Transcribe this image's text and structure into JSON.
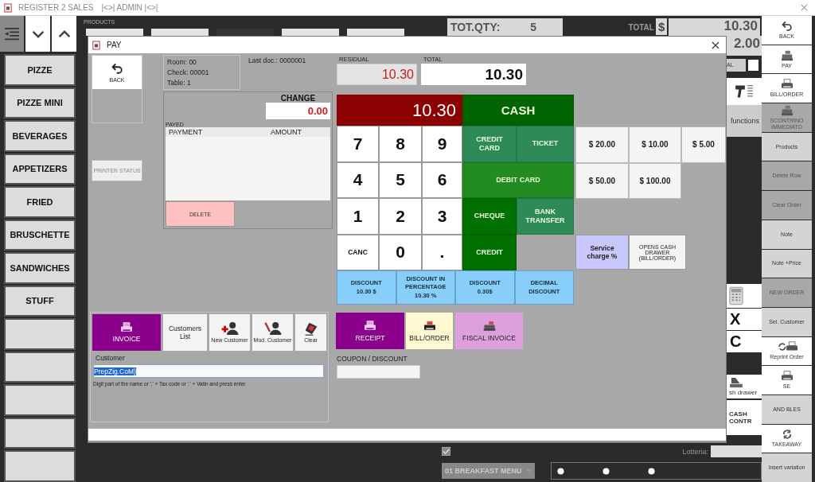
{
  "window": {
    "title": "REGISTER 2 SALES",
    "session": "|<>| ADMIN |<>|"
  },
  "categories": [
    {
      "label": "PIZZE"
    },
    {
      "label": "PIZZE MINI"
    },
    {
      "label": "BEVERAGES"
    },
    {
      "label": "APPETIZERS"
    },
    {
      "label": "FRIED"
    },
    {
      "label": "BRUSCHETTE"
    },
    {
      "label": "SANDWICHES"
    },
    {
      "label": "STUFF"
    }
  ],
  "products": {
    "title": "PRODUCTS"
  },
  "summary": {
    "qty_label": "TOT.QTY:",
    "qty": "5",
    "total_label": "TOTAL",
    "currency": "$",
    "total": "10.30",
    "subtotal": "2.00",
    "subtotal_label": "AL"
  },
  "side_panel": {
    "functions": "functions",
    "clear_x": "X",
    "clear_c": "C",
    "drawer": "sh drawer",
    "cash_control": "CASH CONTR"
  },
  "right_menu": [
    {
      "label": "BACK",
      "kind": "back",
      "disabled": false
    },
    {
      "label": "PAY",
      "kind": "register",
      "disabled": false
    },
    {
      "label": "BILL/ORDER",
      "kind": "printer",
      "disabled": false
    },
    {
      "label": "SCONTRINO IMMEDIATO",
      "kind": "register",
      "disabled": true
    },
    {
      "label": "Products",
      "kind": "plain",
      "disabled": false
    },
    {
      "label": "Delete Row",
      "kind": "plain",
      "disabled": true
    },
    {
      "label": "Clear Order",
      "kind": "plain",
      "disabled": true
    },
    {
      "label": "Note",
      "kind": "plain",
      "disabled": false
    },
    {
      "label": "Note +Price",
      "kind": "plain",
      "disabled": false
    },
    {
      "label": "NEW ORDER",
      "kind": "plain",
      "disabled": true
    },
    {
      "label": "Sel. Customer",
      "kind": "plain",
      "disabled": false
    },
    {
      "label": "Reprint Order",
      "kind": "reprint",
      "disabled": false
    },
    {
      "label": "SE",
      "kind": "printer",
      "disabled": false
    },
    {
      "label": "AND BLES",
      "kind": "plain",
      "disabled": false
    },
    {
      "label": "TAKEAWAY",
      "kind": "takeaway",
      "disabled": false
    },
    {
      "label": "Insert variation",
      "kind": "plain",
      "disabled": false
    }
  ],
  "bottom_bar": {
    "price_option_checked": true,
    "lottery_label": "Lotteria:",
    "menu": "01 BREAKFAST MENU",
    "radios": [
      {
        "selected": false
      },
      {
        "selected": false
      },
      {
        "selected": false
      }
    ]
  },
  "dialog": {
    "title": "PAY",
    "back": "BACK",
    "printer_status": "PRINTER STATUS",
    "info": [
      "Room: 00",
      "Check: 00001",
      "Table:  1"
    ],
    "last_doc": "Last doc.: 0000001",
    "residual_label": "RESIDUAL",
    "residual": "10.30",
    "total_label": "TOTAL",
    "total": "10.30",
    "change_label": "CHANGE",
    "change": "0.00",
    "payed_label": "PAYED",
    "payed_columns": [
      "PAYMENT",
      "AMOUNT"
    ],
    "delete": "DELETE",
    "display": "10.30",
    "keys": [
      {
        "label": "7",
        "kind": "digit"
      },
      {
        "label": "8",
        "kind": "digit"
      },
      {
        "label": "9",
        "kind": "digit"
      },
      {
        "label": "4",
        "kind": "digit"
      },
      {
        "label": "5",
        "kind": "digit"
      },
      {
        "label": "6",
        "kind": "digit"
      },
      {
        "label": "1",
        "kind": "digit"
      },
      {
        "label": "2",
        "kind": "digit"
      },
      {
        "label": "3",
        "kind": "digit"
      },
      {
        "label": "CANC",
        "kind": "command"
      },
      {
        "label": "0",
        "kind": "digit"
      },
      {
        "label": ".",
        "kind": "digit"
      }
    ],
    "methods": [
      {
        "label": "CASH",
        "color": "#006400"
      },
      {
        "label": "CREDIT CARD",
        "color": "#2e8b57"
      },
      {
        "label": "TICKET",
        "color": "#2e8b57"
      },
      {
        "label": "DEBIT CARD",
        "color": "#228b22"
      },
      {
        "label": "CHEQUE",
        "color": "#007000"
      },
      {
        "label": "BANK TRANSFER",
        "color": "#2e8b57"
      },
      {
        "label": "CREDIT",
        "color": "#007000"
      }
    ],
    "discounts": [
      "DISCOUNT 10.30 $",
      "DISCOUNT IN PERCENTAGE 10.30 %",
      "DISCOUNT 0.30$",
      "DECIMAL DISCOUNT"
    ],
    "amounts": [
      "$ 20.00",
      "$ 10.00",
      "$ 5.00",
      "$ 50.00",
      "$ 100.00"
    ],
    "extras": [
      {
        "label": "Service charge  %",
        "color": "#c8c8ff"
      },
      {
        "label": "OPENS CASH DRAWER (BILL/ORDER)",
        "color": "#f4f4f4"
      }
    ],
    "customer_actions": [
      {
        "label": "INVOICE",
        "kind": "printer",
        "color": "#8b008b"
      },
      {
        "label": "Customers List",
        "kind": "text",
        "color": "#f4f4f4"
      },
      {
        "label": "New Customer",
        "kind": "add-person",
        "color": "#f4f4f4"
      },
      {
        "label": "Mod. Customer",
        "kind": "edit-person",
        "color": "#f4f4f4"
      },
      {
        "label": "Clear",
        "kind": "eraser",
        "color": "#f4f4f4"
      }
    ],
    "customer_label": "Customer",
    "customer_value": "PrepZig.CoM)",
    "customer_value_selected": true,
    "customer_hint": "Digit part of the name or ',' + Tax code or '.' + Vatin and press enter",
    "documents": [
      {
        "label": "RECEIPT",
        "kind": "printer",
        "color": "#8b008b"
      },
      {
        "label": "BILL/ORDER",
        "kind": "printer",
        "color": "#fff8d0"
      },
      {
        "label": "FISCAL INVOICE",
        "kind": "register",
        "color": "#dda0dd"
      }
    ],
    "coupon_label": "COUPON / DISCOUNT"
  }
}
